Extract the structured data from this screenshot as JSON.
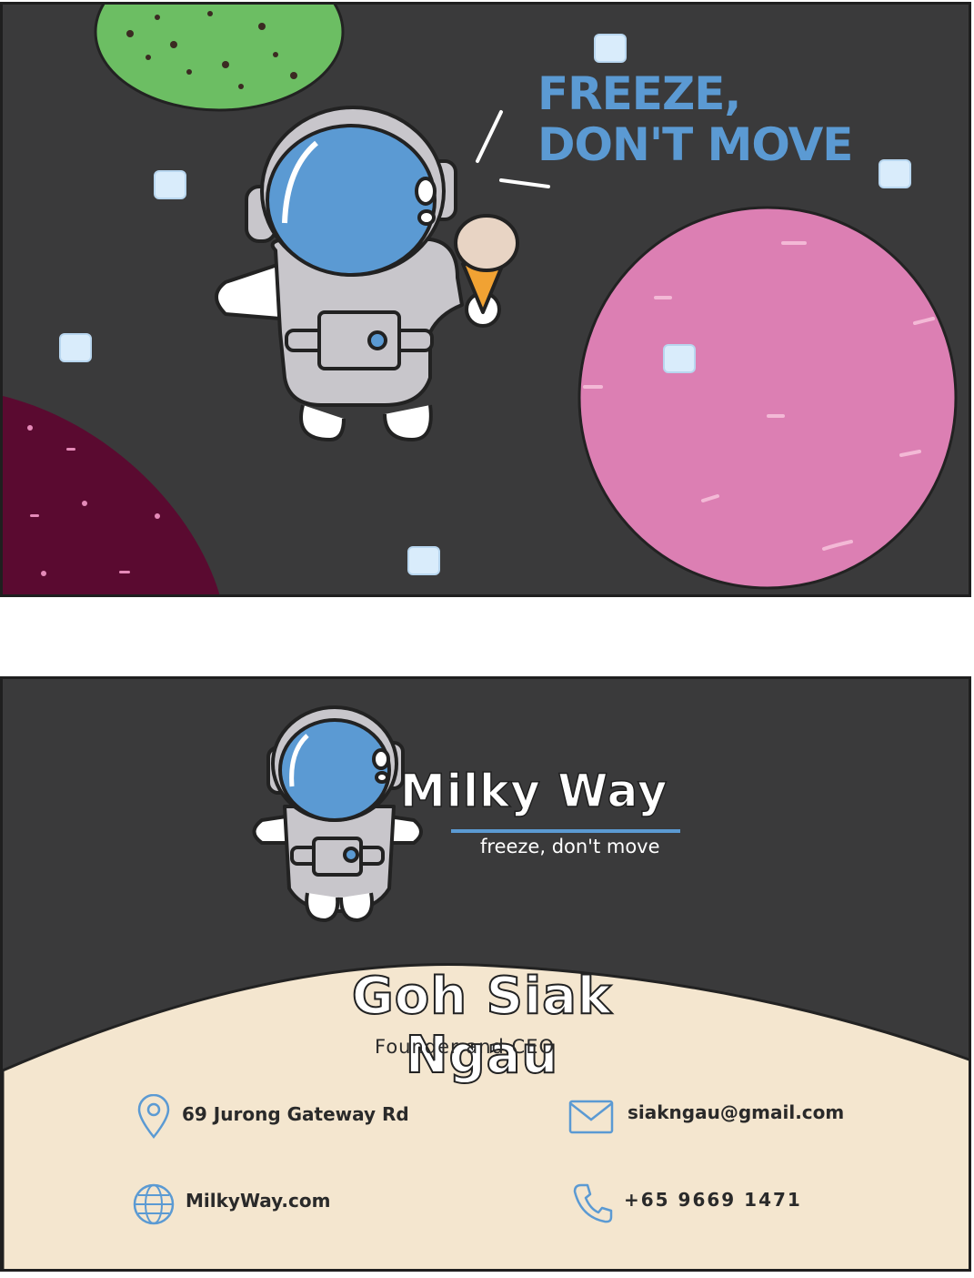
{
  "front": {
    "headline_line1": "FREEZE,",
    "headline_line2": "DON'T MOVE"
  },
  "back": {
    "brand_name": "Milky Way",
    "tagline": "freeze, don't move",
    "person_name": "Goh Siak Ngau",
    "person_title": "Founder and CEO",
    "contacts": {
      "address": "69 Jurong Gateway Rd",
      "email": "siakngau@gmail.com",
      "website": "MilkyWay.com",
      "phone": "+65 9669 1471"
    }
  },
  "colors": {
    "space": "#3a3a3b",
    "accent_blue": "#5b9ad3",
    "pink_planet": "#dc7fb3",
    "green_planet": "#6cbe63",
    "maroon_planet": "#5a0a30",
    "cream": "#f4e6cf"
  },
  "icons": [
    "location-pin-icon",
    "envelope-icon",
    "globe-icon",
    "phone-icon"
  ]
}
